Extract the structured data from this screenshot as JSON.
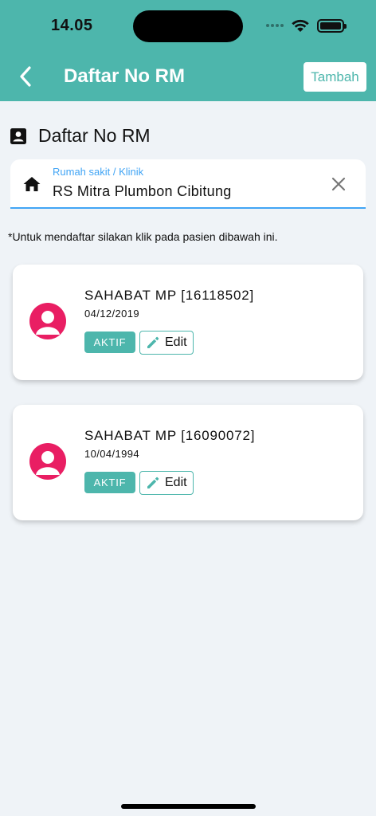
{
  "status_bar": {
    "time": "14.05"
  },
  "header": {
    "title": "Daftar No RM",
    "add_label": "Tambah"
  },
  "section": {
    "title": "Daftar No RM"
  },
  "hospital_field": {
    "label": "Rumah sakit / Klinik",
    "value": "RS Mitra Plumbon Cibitung"
  },
  "hint": "*Untuk mendaftar silakan klik pada pasien dibawah ini.",
  "patients": [
    {
      "name": "SAHABAT MP [16118502]",
      "date": "04/12/2019",
      "status": "AKTIF",
      "edit_label": "Edit"
    },
    {
      "name": "SAHABAT MP [16090072]",
      "date": "10/04/1994",
      "status": "AKTIF",
      "edit_label": "Edit"
    }
  ],
  "colors": {
    "primary": "#4db6ac",
    "accent_blue": "#42a5f5",
    "avatar": "#e91e63",
    "background": "#eff3f7"
  },
  "icons": [
    "back-chevron-icon",
    "contact-card-icon",
    "home-icon",
    "close-icon",
    "person-icon",
    "pencil-icon",
    "wifi-icon",
    "battery-icon"
  ]
}
